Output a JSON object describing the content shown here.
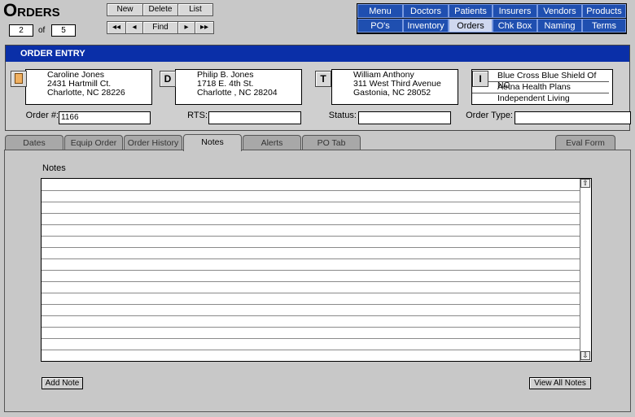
{
  "app": {
    "title": "Orders",
    "record_current": "2",
    "record_of": "of",
    "record_total": "5"
  },
  "toolbar": {
    "new": "New",
    "delete": "Delete",
    "list": "List",
    "first": "◂◂",
    "prev": "◂",
    "find": "Find",
    "next": "▸",
    "last": "▸▸"
  },
  "nav": {
    "row1": [
      "Menu",
      "Doctors",
      "Patients",
      "Insurers",
      "Vendors",
      "Products"
    ],
    "row2": [
      "PO's",
      "Inventory",
      "Orders",
      "Chk Box",
      "Naming",
      "Terms"
    ],
    "active": "Orders"
  },
  "entry": {
    "header": "ORDER ENTRY",
    "patient": {
      "icon": "person-card-icon",
      "name": "Caroline Jones",
      "street": "2431 Hartmill Ct.",
      "city": "Charlotte, NC 28226"
    },
    "doctor": {
      "letter": "D",
      "name": "Philip B. Jones",
      "street": "1718 E. 4th St.",
      "city": "Charlotte , NC 28204"
    },
    "therapist": {
      "letter": "T",
      "name": "William Anthony",
      "street": "311 West Third Avenue",
      "city": "Gastonia, NC 28052"
    },
    "insurer": {
      "letter": "I",
      "lines": [
        "Blue Cross Blue Shield Of NC",
        "Aetna Health Plans",
        "Independent Living Rehabilitation Program"
      ]
    },
    "order_no_label": "Order #:",
    "order_no": "1166",
    "rts_label": "RTS:",
    "rts": "",
    "status_label": "Status:",
    "status": "",
    "order_type_label": "Order Type:",
    "order_type": ""
  },
  "tabs": [
    "Dates",
    "Equip Order",
    "Order History",
    "Notes",
    "Alerts",
    "PO Tab",
    "Eval Form"
  ],
  "active_tab": "Notes",
  "notes": {
    "label": "Notes",
    "add_note": "Add Note",
    "view_all": "View All Notes",
    "scroll_up": "⇧",
    "scroll_down": "⇩"
  }
}
